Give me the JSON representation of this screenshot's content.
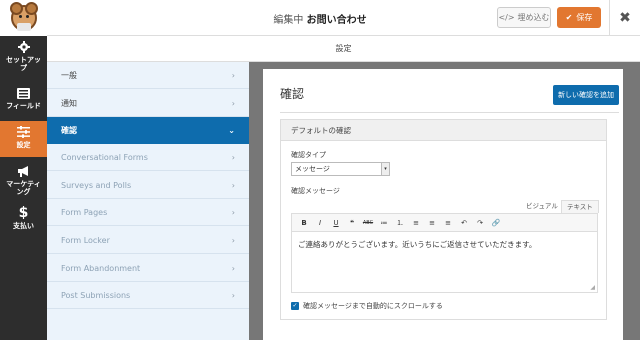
{
  "header": {
    "title_prefix": "編集中",
    "title_form": "お問い合わせ",
    "embed_label": "埋め込む",
    "embed_icon": "code-icon",
    "save_label": "保存",
    "save_icon": "check-icon",
    "close_symbol": "✖"
  },
  "rail": {
    "items": [
      {
        "label": "セットアップ",
        "icon": "gear-icon"
      },
      {
        "label": "フィールド",
        "icon": "list-icon"
      },
      {
        "label": "設定",
        "icon": "sliders-icon"
      },
      {
        "label": "マーケティング",
        "icon": "megaphone-icon"
      },
      {
        "label": "支払い",
        "icon": "dollar-icon"
      }
    ]
  },
  "section_title": "設定",
  "panel": {
    "items": [
      {
        "label": "一般"
      },
      {
        "label": "通知"
      },
      {
        "label": "確認"
      },
      {
        "label": "Conversational Forms"
      },
      {
        "label": "Surveys and Polls"
      },
      {
        "label": "Form Pages"
      },
      {
        "label": "Form Locker"
      },
      {
        "label": "Form Abandonment"
      },
      {
        "label": "Post Submissions"
      }
    ]
  },
  "main": {
    "title": "確認",
    "add_button": "新しい確認を追加",
    "box_title": "デフォルトの確認",
    "type_label": "確認タイプ",
    "type_value": "メッセージ",
    "message_label": "確認メッセージ",
    "tab_visual": "ビジュアル",
    "tab_text": "テキスト",
    "toolbar": [
      "B",
      "I",
      "U",
      "❝",
      "ABC",
      "≔",
      "⒈",
      "≡",
      "≡",
      "≡",
      "↶",
      "↷",
      "🔗"
    ],
    "message_text": "ご連絡ありがとうございます。近いうちにご返信させていただきます。",
    "scroll_label": "確認メッセージまで自動的にスクロールする"
  },
  "colors": {
    "accent": "#e27730",
    "primary": "#0e6cad",
    "rail_bg": "#2d2d2d",
    "panel_bg": "#ebf3fb"
  }
}
